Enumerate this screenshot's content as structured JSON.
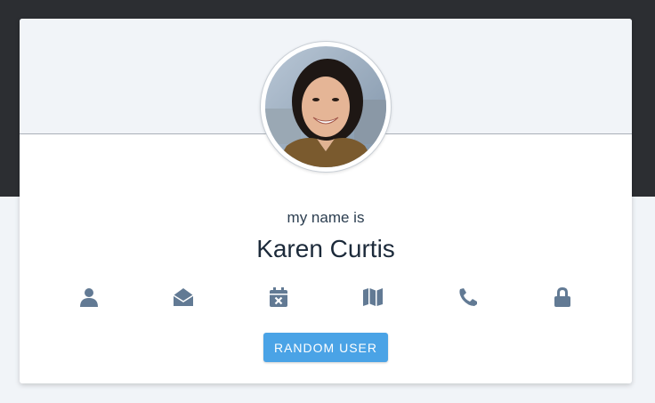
{
  "profile": {
    "label": "my name is",
    "name": "Karen Curtis"
  },
  "icons": [
    {
      "icon": "user-icon"
    },
    {
      "icon": "envelope-open-icon"
    },
    {
      "icon": "calendar-times-icon"
    },
    {
      "icon": "map-icon"
    },
    {
      "icon": "phone-icon"
    },
    {
      "icon": "lock-icon"
    }
  ],
  "button": {
    "label": "RANDOM USER"
  },
  "colors": {
    "top_band": "#2c2e32",
    "icon": "#627a94",
    "button": "#4aa3e6",
    "header": "#f1f4f8"
  }
}
